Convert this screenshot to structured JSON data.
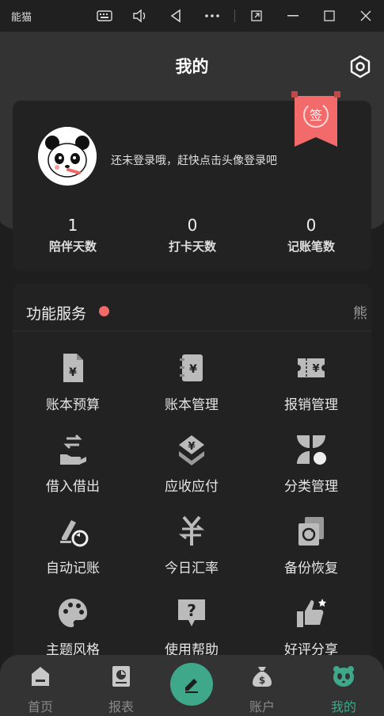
{
  "topbar": {
    "app_name": "能猫"
  },
  "header": {
    "title": "我的"
  },
  "profile": {
    "login_prompt": "还未登录哦，赶快点击头像登录吧",
    "stats": [
      {
        "value": "1",
        "label": "陪伴天数"
      },
      {
        "value": "0",
        "label": "打卡天数"
      },
      {
        "value": "0",
        "label": "记账笔数"
      }
    ],
    "sign_label": "签"
  },
  "services": {
    "title": "功能服务",
    "badge_char": "熊",
    "items": [
      {
        "label": "账本预算",
        "icon": "budget-icon"
      },
      {
        "label": "账本管理",
        "icon": "ledger-icon"
      },
      {
        "label": "报销管理",
        "icon": "reimburse-icon"
      },
      {
        "label": "借入借出",
        "icon": "lend-icon"
      },
      {
        "label": "应收应付",
        "icon": "receivable-icon"
      },
      {
        "label": "分类管理",
        "icon": "category-icon"
      },
      {
        "label": "自动记账",
        "icon": "auto-record-icon"
      },
      {
        "label": "今日汇率",
        "icon": "exchange-rate-icon"
      },
      {
        "label": "备份恢复",
        "icon": "backup-icon"
      },
      {
        "label": "主题风格",
        "icon": "theme-icon"
      },
      {
        "label": "使用帮助",
        "icon": "help-icon"
      },
      {
        "label": "好评分享",
        "icon": "thumbs-up-icon"
      }
    ]
  },
  "tabs": [
    {
      "label": "首页"
    },
    {
      "label": "报表"
    },
    {
      "label": "账户"
    },
    {
      "label": "我的"
    }
  ],
  "colors": {
    "accent": "#3fa88a",
    "active_tab": "#3fa88a",
    "dot": "#f06a6a",
    "ribbon": "#f26a6a"
  }
}
